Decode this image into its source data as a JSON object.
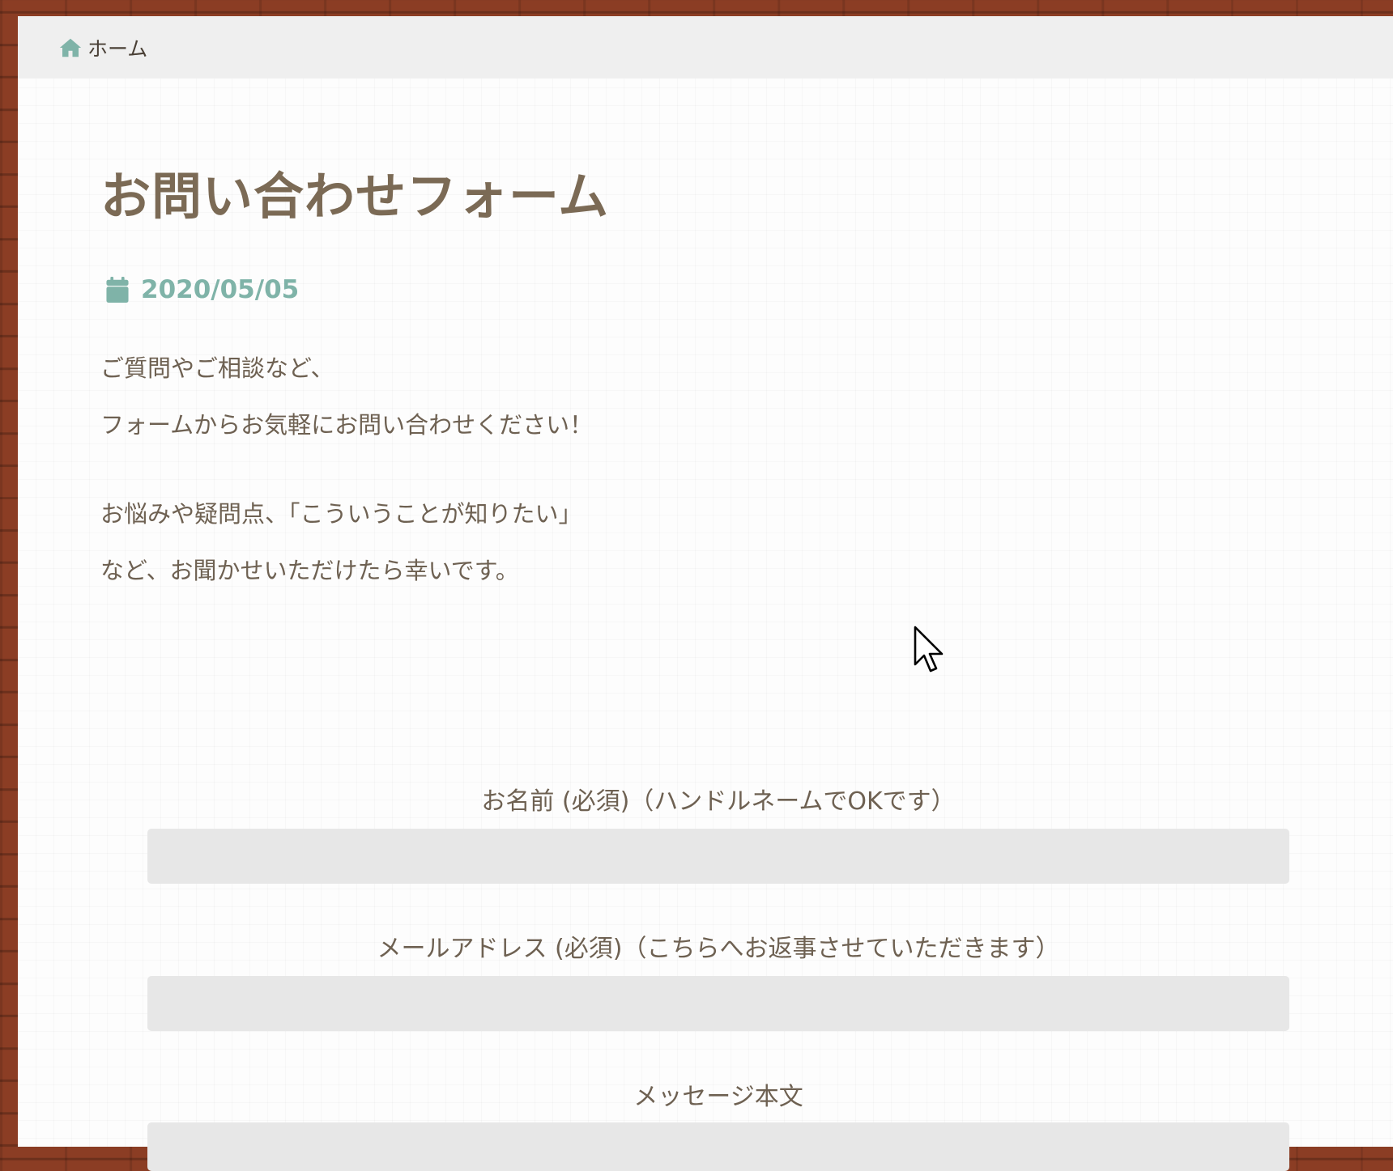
{
  "breadcrumb": {
    "home_label": "ホーム",
    "icon": "home-icon",
    "icon_color": "#7fb3a8"
  },
  "article": {
    "title": "お問い合わせフォーム",
    "date": "2020/05/05",
    "date_icon": "calendar-icon",
    "date_color": "#7fb3a8",
    "paragraphs": [
      "ご質問やご相談など、",
      "フォームからお気軽にお問い合わせください！",
      "お悩みや疑問点、「こういうことが知りたい」",
      "など、お聞かせいただけたら幸いです。"
    ]
  },
  "form": {
    "name_label": "お名前 (必須)（ハンドルネームでOKです）",
    "name_value": "",
    "email_label": "メールアドレス (必須)（こちらへお返事させていただきます）",
    "email_value": "",
    "message_label": "メッセージ本文",
    "message_value": ""
  },
  "colors": {
    "title": "#7b6a55",
    "text": "#6e6152",
    "accent": "#7fb3a8",
    "frame": "#8b3d24",
    "input_bg": "#e7e7e7"
  }
}
